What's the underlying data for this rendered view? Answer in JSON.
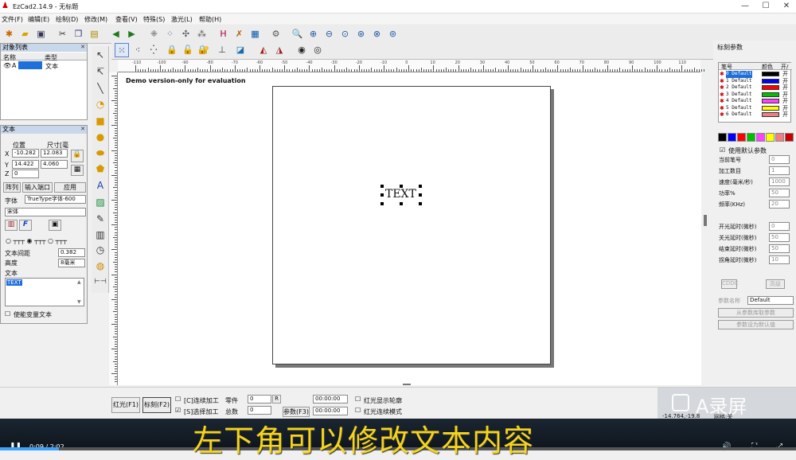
{
  "window": {
    "title": "EzCad2.14.9 - 无标题"
  },
  "menu": [
    "文件(F)",
    "编辑(E)",
    "绘制(D)",
    "修改(M)",
    "查看(V)",
    "特殊(S)",
    "激光(L)",
    "帮助(H)"
  ],
  "object_list": {
    "title": "对象列表",
    "col_name": "名称",
    "col_type": "类型",
    "row_name": "A",
    "row_type": "文本"
  },
  "text_panel": {
    "title": "文本",
    "pos_label": "位置",
    "size_label": "尺寸[毫",
    "x_label": "X",
    "y_label": "Y",
    "z_label": "Z",
    "x_pos": "-10.282",
    "x_size": "12.083",
    "y_pos": "14.422",
    "y_size": "4.060",
    "z_val": "0",
    "array_btn": "阵列",
    "input_port_btn": "输入端口",
    "apply_btn": "应用",
    "font_label": "字体",
    "font_type": "TrueType字体-600",
    "font_name": "宋体",
    "spacing_label": "文本间距",
    "spacing_val": "0.382",
    "height_label": "高度",
    "height_val": "8毫米",
    "text_label": "文本",
    "text_value": "TEXT",
    "var_text_label": "使能变量文本"
  },
  "canvas": {
    "demo_text": "Demo version-only for evaluation",
    "object_text": "TEXT"
  },
  "ruler_h_labels": [
    "-110",
    "-100",
    "-90",
    "-80",
    "-70",
    "-60",
    "-50",
    "-40",
    "-30",
    "-20",
    "-10",
    "0",
    "10",
    "20",
    "30",
    "40",
    "50",
    "60",
    "70",
    "80",
    "90",
    "100",
    "110"
  ],
  "marking_params": {
    "title": "标刻参数",
    "col_pen": "笔号",
    "col_color": "颜色",
    "col_on": "开/",
    "pens": [
      {
        "name": "0 Default",
        "color": "#000000",
        "on": "开"
      },
      {
        "name": "1 Default",
        "color": "#0000ff",
        "on": "开"
      },
      {
        "name": "2 Default",
        "color": "#ff0000",
        "on": "开"
      },
      {
        "name": "3 Default",
        "color": "#00c000",
        "on": "开"
      },
      {
        "name": "4 Default",
        "color": "#ff40ff",
        "on": "开"
      },
      {
        "name": "5 Default",
        "color": "#ffff00",
        "on": "开"
      },
      {
        "name": "6 Default",
        "color": "#f08080",
        "on": "开"
      }
    ],
    "palette": [
      "#000000",
      "#0000ff",
      "#ff0000",
      "#00c000",
      "#ff40ff",
      "#ffff00",
      "#f08080",
      "#cc0000"
    ],
    "use_default": "使用默认参数",
    "fields": [
      {
        "label": "当前笔号",
        "value": "0"
      },
      {
        "label": "加工数目",
        "value": "1"
      },
      {
        "label": "速度(毫米/秒)",
        "value": "1000"
      },
      {
        "label": "功率%",
        "value": "50"
      },
      {
        "label": "频率(KHz)",
        "value": "20"
      },
      {
        "label": "开光延时(微秒)",
        "value": "0"
      },
      {
        "label": "关光延时(微秒)",
        "value": "50"
      },
      {
        "label": "结束延时(微秒)",
        "value": "50"
      },
      {
        "label": "拐角延时(微秒)",
        "value": "10"
      }
    ],
    "btn_cd": "CDDC",
    "btn_advanced": "高级",
    "param_name_label": "参数名称",
    "param_name_value": "Default",
    "btn_read": "从参数库取参数",
    "btn_set_default": "参数设为默认值"
  },
  "bottom": {
    "red_btn": "红光(F1)",
    "mark_btn": "标刻(F2)",
    "continuous": "[C]连续加工",
    "selected": "[S]选择加工",
    "parts_label": "零件",
    "parts_val": "0",
    "total_label": "总数",
    "total_val": "0",
    "r_btn": "R",
    "param_btn": "参数(F3)",
    "time1": "00:00:00",
    "time2": "00:00:00",
    "red_outline": "红光显示轮廓",
    "red_continuous": "红光连续模式",
    "status_coord": "-14.764,-19.8",
    "status_grid": "网格:关"
  },
  "video": {
    "time": "0:09 / 2:02",
    "subtitle": "左下角可以修改文本内容",
    "watermark": "A录屏"
  }
}
